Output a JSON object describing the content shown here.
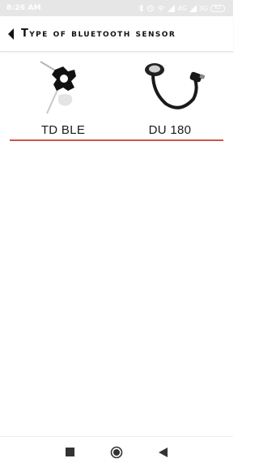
{
  "status_bar": {
    "time": "8:26 AM",
    "network_label_1": "4G",
    "network_label_2": "3G",
    "battery": "62",
    "icons": [
      "bluetooth-icon",
      "alarm-icon",
      "wifi-icon",
      "signal-icon",
      "battery-icon"
    ]
  },
  "app_bar": {
    "title": "Type of bluetooth sensor",
    "back_icon": "back-arrow-icon"
  },
  "sensors": [
    {
      "label": "TD BLE",
      "icon": "td-ble-sensor-image"
    },
    {
      "label": "DU 180",
      "icon": "du-180-sensor-image"
    }
  ],
  "colors": {
    "divider": "#c9574b",
    "status_bar_bg": "#e6e6e6"
  },
  "nav_bar": {
    "icons": [
      "recents-square-icon",
      "home-circle-icon",
      "back-triangle-icon"
    ]
  }
}
